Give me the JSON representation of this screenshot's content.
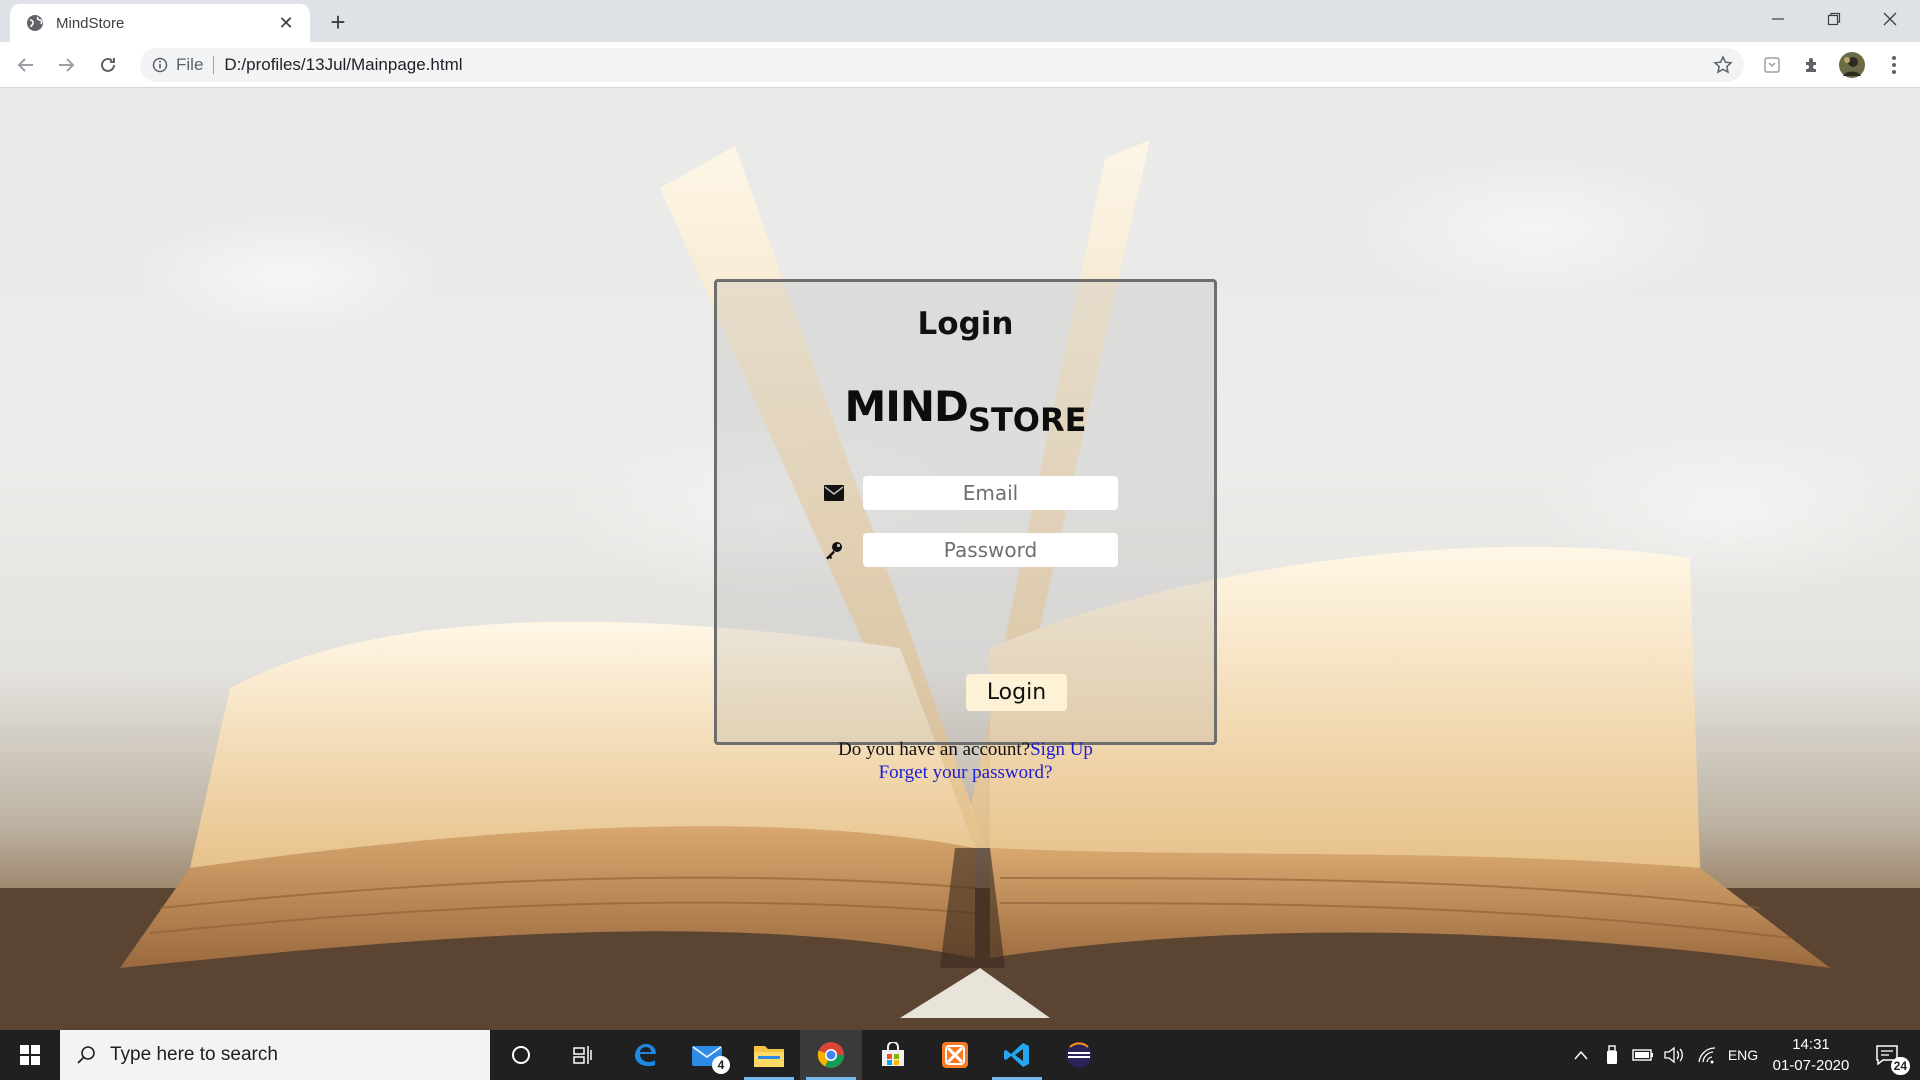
{
  "browser": {
    "tab_title": "MindStore",
    "new_tab": "+",
    "url_scheme": "File",
    "url_path": "D:/profiles/13Jul/Mainpage.html"
  },
  "page": {
    "login_heading": "Login",
    "brand_big": "MIND",
    "brand_small": "STORE",
    "email_placeholder": "Email",
    "password_placeholder": "Password",
    "login_button": "Login",
    "account_prompt": "Do you have an account?",
    "signup_link": "Sign Up",
    "forgot_link": "Forget your password?"
  },
  "taskbar": {
    "search_placeholder": "Type here to search",
    "mail_badge": "4",
    "language": "ENG",
    "time": "14:31",
    "date": "01-07-2020",
    "notification_count": "24"
  },
  "colors": {
    "tab_strip": "#dee1e6",
    "login_button_bg": "#fdf1d6",
    "link": "#1b1bd6",
    "taskbar_bg": "#202020"
  }
}
